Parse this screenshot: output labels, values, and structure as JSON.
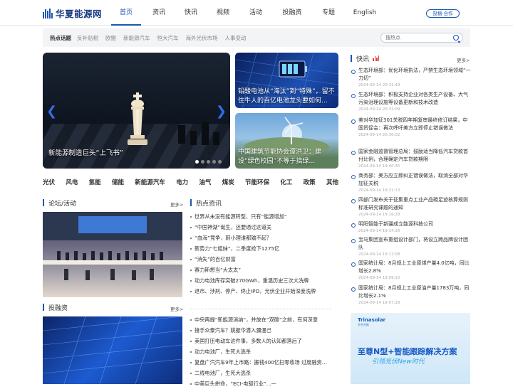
{
  "header": {
    "logo_text": "华夏能源网",
    "nav": [
      "首页",
      "资讯",
      "快讯",
      "视频",
      "活动",
      "投融资",
      "专题",
      "English"
    ],
    "active_index": 0,
    "subscribe_label": "投稿·合作"
  },
  "topics": {
    "label": "热点话题",
    "items": [
      "反补贴税",
      "欧盟",
      "新能源汽车",
      "恒大汽车",
      "海外光伏市场",
      "人事变动"
    ],
    "search_placeholder": "搜热点"
  },
  "hero": {
    "main_caption": "新能源制造巨头“上飞书”",
    "side1_caption": "铅酸电池从“海汰”到“特殊”，留不住牛人的百亿电池龙头要如何…",
    "side2_caption": "中国建筑节能协会谭洪卫：建设“绿色校园”不等于搞绿…"
  },
  "categories": [
    "光伏",
    "风电",
    "氢能",
    "储能",
    "新能源汽车",
    "电力",
    "油气",
    "煤炭",
    "节能环保",
    "化工",
    "政策",
    "其他"
  ],
  "forum": {
    "title": "论坛/活动",
    "more": "更多>"
  },
  "touzi": {
    "title": "投融资",
    "more": "更多>"
  },
  "hot": {
    "title": "热点资讯",
    "group1": [
      "世界从未没有能源转型，只有“能源增加”",
      "“中国神湖”诞生，还要通过这道关",
      "“血海”竞争，蔚小理谁都输不起？",
      "新势力“七姐妹”，二季度抢下1275亿",
      "“消失”的百亿财富",
      "赛力斯想当“大太太”",
      "动力电池库存突破270GWh，重温历史三次大洗牌",
      "退市、涉刑、停产、终止IPO，光伏企业开始深度洗牌"
    ],
    "group2": [
      "中央再提“新能源消纳”，并放在“双碳”之前，有何深意",
      "接手众泰汽车？姚振华潜入瀰漫己",
      "美国打压电动车这件事，多数人的认知都落后了",
      "动力电池厂，生死大逃杀",
      "复盘广汽汽车9年上市路：搬钱400亿扫零收场 过度融资…",
      "二线电池厂，生死大逃杀",
      "中美巨头拼命，“ECI-电驱行业”...一"
    ]
  },
  "kuaixun": {
    "title": "快讯",
    "more": "更多>",
    "items": [
      {
        "title": "生态环境部：优化环境执法，严禁生态环境领域“一刀切”",
        "time": "2024-09-14 20:31:49"
      },
      {
        "title": "生态环境部：积极支持企业对各类生产设备、大气污染治理设施等设备更新和技术改造",
        "time": "2024-09-14 20:31:09"
      },
      {
        "title": "美对华加征301关税四年期复审最终修订结果，中国贸促会：再次呼吁美方立即停止错误做法",
        "time": "2024-09-14 20:30:02"
      },
      {
        "title": "国家金融监督管理总局：鼓励适当降低汽车贷款首付比例，合理确定汽车贷款期限",
        "time": "2024-09-14 19:40:35"
      },
      {
        "title": "商务部：美方应立即纠正错误做法，取消全部对华加征关税",
        "time": "2024-09-14 19:21:13"
      },
      {
        "title": "四部门发布关于征集重点工业产品碳足迹核算规则标准研究课题的通知",
        "time": "2024-09-14 19:16:28"
      },
      {
        "title": "明阳智能于新疆成立能源科技公司",
        "time": "2024-09-14 19:14:26"
      },
      {
        "title": "宝马集团宣布重组设计部门，将设立跨品牌设计团队",
        "time": "2024-09-14 19:11:08"
      },
      {
        "title": "国家统计局：8月规上工业原煤产量4.0亿吨，同比增长2.8%",
        "time": "2024-09-14 19:09:10"
      },
      {
        "title": "国家统计局：8月规上工业原油产量1783万吨，同比增长2.1%",
        "time": "2024-09-14 19:07:28"
      }
    ]
  },
  "ad": {
    "brand": "Trinasolar",
    "brand_sub": "天合光能",
    "headline": "至尊N型+智能跟踪解决方案",
    "slogan": "引领光伏New时代"
  }
}
